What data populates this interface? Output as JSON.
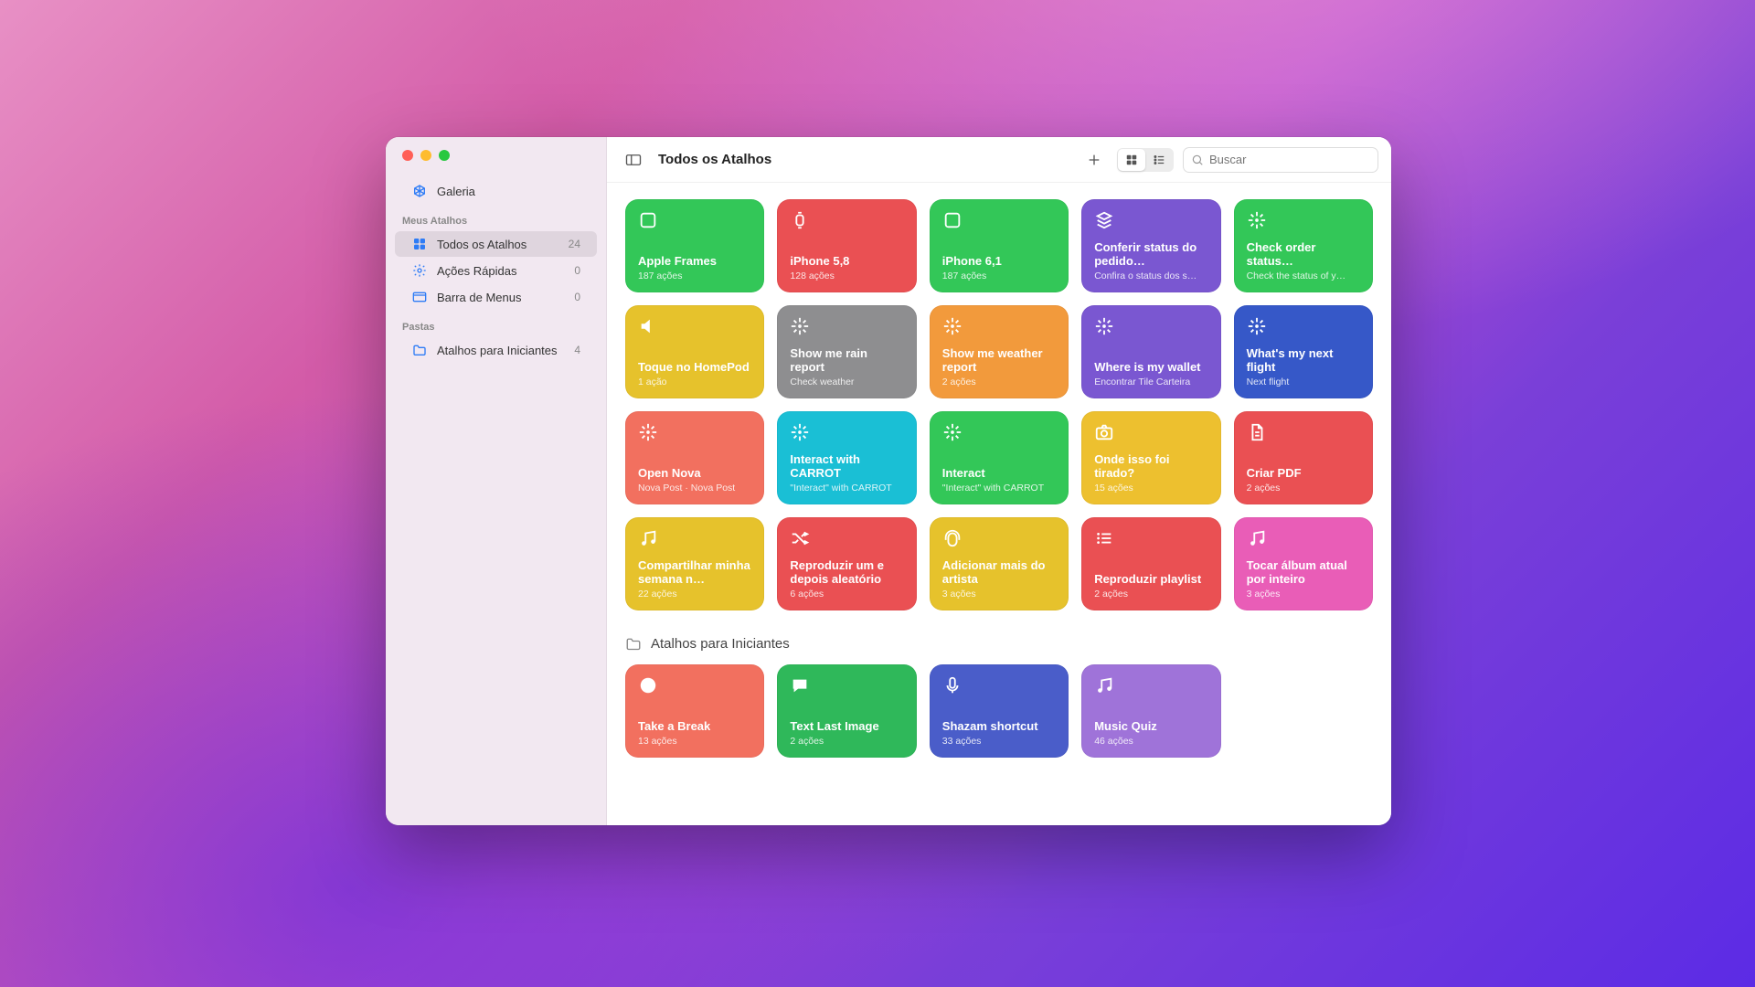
{
  "header": {
    "title": "Todos os Atalhos",
    "search_placeholder": "Buscar"
  },
  "sidebar": {
    "gallery_label": "Galeria",
    "section_my_label": "Meus Atalhos",
    "section_folders_label": "Pastas",
    "items": [
      {
        "icon": "grid",
        "label": "Todos os Atalhos",
        "count": "24",
        "selected": true
      },
      {
        "icon": "gear",
        "label": "Ações Rápidas",
        "count": "0"
      },
      {
        "icon": "menubar",
        "label": "Barra de Menus",
        "count": "0"
      }
    ],
    "folders": [
      {
        "label": "Atalhos para Iniciantes",
        "count": "4"
      }
    ]
  },
  "shortcuts_main": [
    {
      "color": "c-green",
      "icon": "square",
      "title": "Apple Frames",
      "sub": "187 ações"
    },
    {
      "color": "c-red",
      "icon": "watch",
      "title": "iPhone 5,8",
      "sub": "128 ações"
    },
    {
      "color": "c-green",
      "icon": "square",
      "title": "iPhone 6,1",
      "sub": "187 ações"
    },
    {
      "color": "c-purple",
      "icon": "layers",
      "title": "Conferir status do pedido…",
      "sub": "Confira o status dos s…"
    },
    {
      "color": "c-green",
      "icon": "sparkle",
      "title": "Check order status…",
      "sub": "Check the status of y…"
    },
    {
      "color": "c-yellow",
      "icon": "speaker",
      "title": "Toque no HomePod",
      "sub": "1 ação"
    },
    {
      "color": "c-gray",
      "icon": "sparkle",
      "title": "Show me rain report",
      "sub": "Check weather"
    },
    {
      "color": "c-orange",
      "icon": "sparkle",
      "title": "Show me weather report",
      "sub": "2 ações"
    },
    {
      "color": "c-purple",
      "icon": "sparkle",
      "title": "Where is my wallet",
      "sub": "Encontrar Tile Carteira"
    },
    {
      "color": "c-blue",
      "icon": "sparkle",
      "title": "What's my next flight",
      "sub": "Next flight"
    },
    {
      "color": "c-coral",
      "icon": "sparkle",
      "title": "Open Nova",
      "sub": "Nova Post · Nova Post"
    },
    {
      "color": "c-cyan",
      "icon": "sparkle",
      "title": "Interact with CARROT",
      "sub": "\"Interact\" with CARROT"
    },
    {
      "color": "c-green",
      "icon": "sparkle",
      "title": "Interact",
      "sub": "\"Interact\" with CARROT"
    },
    {
      "color": "c-camera",
      "icon": "camera",
      "title": "Onde isso foi tirado?",
      "sub": "15 ações"
    },
    {
      "color": "c-red",
      "icon": "doc",
      "title": "Criar PDF",
      "sub": "2 ações"
    },
    {
      "color": "c-yellow",
      "icon": "music",
      "title": "Compartilhar minha semana n…",
      "sub": "22 ações"
    },
    {
      "color": "c-red",
      "icon": "shuffle",
      "title": "Reproduzir um e depois aleatório",
      "sub": "6 ações"
    },
    {
      "color": "c-yellow",
      "icon": "head",
      "title": "Adicionar mais do artista",
      "sub": "3 ações"
    },
    {
      "color": "c-red",
      "icon": "list",
      "title": "Reproduzir playlist",
      "sub": "2 ações"
    },
    {
      "color": "c-pink",
      "icon": "music",
      "title": "Tocar álbum atual por inteiro",
      "sub": "3 ações"
    }
  ],
  "folder_section": {
    "title": "Atalhos para Iniciantes",
    "items": [
      {
        "color": "c-coral",
        "icon": "clock",
        "title": "Take a Break",
        "sub": "13 ações"
      },
      {
        "color": "c-darkgreen",
        "icon": "chat",
        "title": "Text Last Image",
        "sub": "2 ações"
      },
      {
        "color": "c-indigo",
        "icon": "mic",
        "title": "Shazam shortcut",
        "sub": "33 ações"
      },
      {
        "color": "c-lav",
        "icon": "music",
        "title": "Music Quiz",
        "sub": "46 ações"
      }
    ]
  }
}
